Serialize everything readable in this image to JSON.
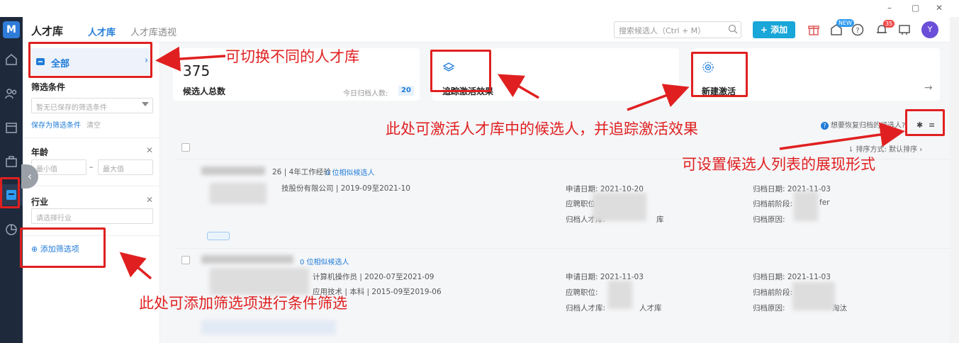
{
  "window": {
    "minimize": "–",
    "maximize": "▢",
    "close": "✕"
  },
  "sidebar_nav": {
    "logo": "M",
    "icons": [
      "home-icon",
      "people-icon",
      "calendar-icon",
      "briefcase-icon",
      "talent-library-icon",
      "chart-pie-icon"
    ]
  },
  "header": {
    "title": "人才库",
    "tabs": [
      {
        "label": "人才库",
        "active": true
      },
      {
        "label": "人才库透视",
        "active": false
      }
    ],
    "search_placeholder": "搜索候选人（Ctrl + M）",
    "add_button": "+ 添加",
    "badge_new": "NEW",
    "badge_count": "35",
    "avatar": "Y"
  },
  "filter_panel": {
    "library_label": "全部",
    "library_arrow": "›",
    "filter_title": "筛选条件",
    "saved_filter_placeholder": "暂无已保存的筛选条件",
    "save_filter_link": "保存为筛选条件",
    "clear_link": "清空",
    "age_label": "年龄",
    "age_min_placeholder": "最小值",
    "age_dash": "–",
    "age_max_placeholder": "最大值",
    "industry_label": "行业",
    "industry_placeholder": "请选择行业",
    "add_filter": "添加筛选项",
    "close_x": "✕"
  },
  "cards": {
    "total": {
      "value": "375",
      "label": "候选人总数",
      "today_label": "今日归档人数:",
      "today_value": "20"
    },
    "track": {
      "label": "追踪激活效果",
      "arrow": "→"
    },
    "new_activation": {
      "label": "新建激活",
      "arrow": "→"
    }
  },
  "list_toolbar": {
    "restore_text": "想要恢复归档的候选人?",
    "sort_label": "排序方式: 默认排序",
    "sort_arrow": "›"
  },
  "rows": [
    {
      "age_exp": "26 | 4年工作经验",
      "similar": "0 位相似候选人",
      "company": "技股份有限公司 | 2019-09至2021-10",
      "apply_date": "申请日期:  2021-10-20",
      "apply_pos": "应聘职位:",
      "archive_lib": "归档人才库:",
      "archive_lib_suffix": "库",
      "archive_date": "归档日期:  2021-11-03",
      "archive_stage": "归档前阶段:",
      "archive_stage_suffix": "fer",
      "archive_reason": "归档原因:"
    },
    {
      "similar": "0 位相似候选人",
      "company": "计算机操作员 | 2020-07至2021-09",
      "edu": "应用技术 | 本科 | 2015-09至2019-06",
      "apply_date": "申请日期:  2021-11-03",
      "apply_pos": "应聘职位:",
      "archive_lib": "归档人才库:",
      "archive_lib_suffix": "人才库",
      "archive_date": "归档日期:  2021-11-03",
      "archive_stage": "归档前阶段:",
      "archive_reason": "归档原因:",
      "archive_reason_suffix": "淘汰"
    }
  ],
  "annotations": {
    "switch_library": "可切换不同的人才库",
    "activate": "此处可激活人才库中的候选人，并追踪激活效果",
    "list_display": "可设置候选人列表的展现形式",
    "add_filter": "此处可添加筛选项进行条件筛选"
  },
  "colors": {
    "accent": "#1f7bd8",
    "annotation": "#e02020",
    "sidebar": "#1e2a3c"
  }
}
